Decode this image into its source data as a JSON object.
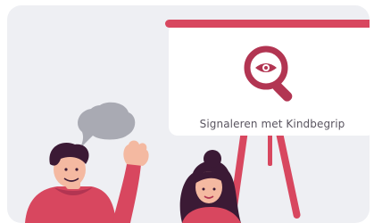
{
  "illustration": {
    "board_caption": "Signaleren met Kindbegrip",
    "icon": "magnifier-eye-icon",
    "colors": {
      "background": "#eeeff3",
      "accent": "#d8475f",
      "accent_dark": "#b23552",
      "board": "#ffffff",
      "speech_bubble": "#a9aab3",
      "hair": "#3b1a35",
      "skin": "#f4b9a1"
    }
  }
}
